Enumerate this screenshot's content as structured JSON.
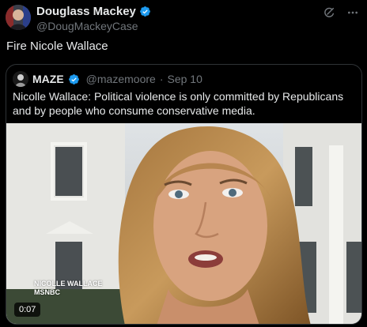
{
  "post": {
    "author_name": "Douglass Mackey",
    "author_handle": "@DougMackeyCase",
    "text": "Fire Nicole Wallace"
  },
  "quoted": {
    "author_name": "MAZE",
    "author_handle": "@mazemoore",
    "separator": "·",
    "date": "Sep 10",
    "text": "Nicolle Wallace: Political violence is only committed by Republicans and by people who consume conservative media."
  },
  "video": {
    "caption_line1": "NICOLLE WALLACE",
    "caption_line2": "MSNBC",
    "duration": "0:07"
  },
  "colors": {
    "background": "#000000",
    "text": "#e7e9ea",
    "muted": "#71767b",
    "verified": "#1d9bf0",
    "border": "#2f3336"
  },
  "icons": {
    "verified": "verified-badge-icon",
    "grok": "grok-icon",
    "more": "more-icon"
  }
}
